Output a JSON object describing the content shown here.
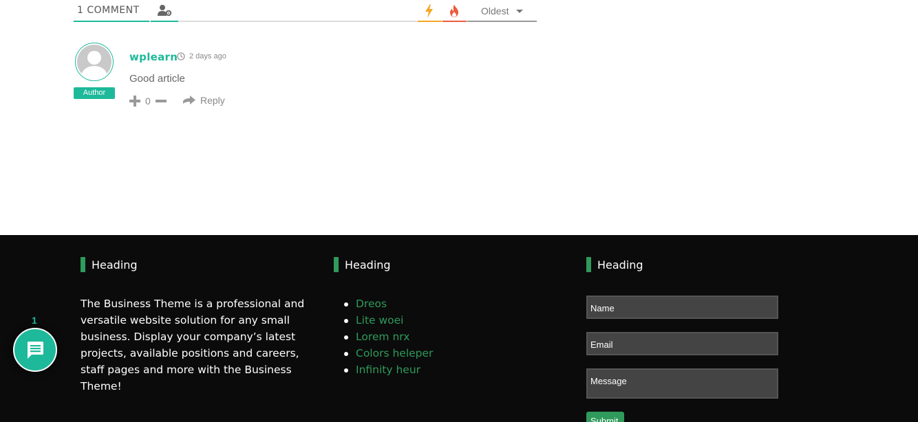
{
  "comments_header": {
    "count_label": "1 COMMENT",
    "subscribe_icon": "user-settings-icon",
    "newest_icon": "lightning-icon",
    "hottest_icon": "flame-icon",
    "order_label": "Oldest"
  },
  "comment": {
    "author": "wplearn",
    "role_badge": "Author",
    "time_ago": "2 days ago",
    "text": "Good article",
    "vote_count": "0",
    "reply_label": "Reply"
  },
  "footer": {
    "col1": {
      "heading": "Heading",
      "about": "The Business Theme is a professional and versatile website solution for any small business. Display your company’s latest projects, available positions and careers, staff pages and more with the Business Theme!"
    },
    "col2": {
      "heading": "Heading",
      "links": [
        "Dreos",
        "Lite woei",
        "Lorem nrx",
        "Colors heleper",
        "Infinity heur"
      ]
    },
    "col3": {
      "heading": "Heading",
      "name_placeholder": "Name",
      "email_placeholder": "Email",
      "message_placeholder": "Message",
      "submit_label": "Submit"
    }
  },
  "chat_widget": {
    "count": "1",
    "icon": "chat-bubble-icon"
  },
  "colors": {
    "accent_teal": "#1db99a",
    "footer_green": "#2f9a5b",
    "footer_bg": "#0b0b0b",
    "newest_orange": "#f5a623",
    "hottest_red": "#ee5a3e"
  }
}
